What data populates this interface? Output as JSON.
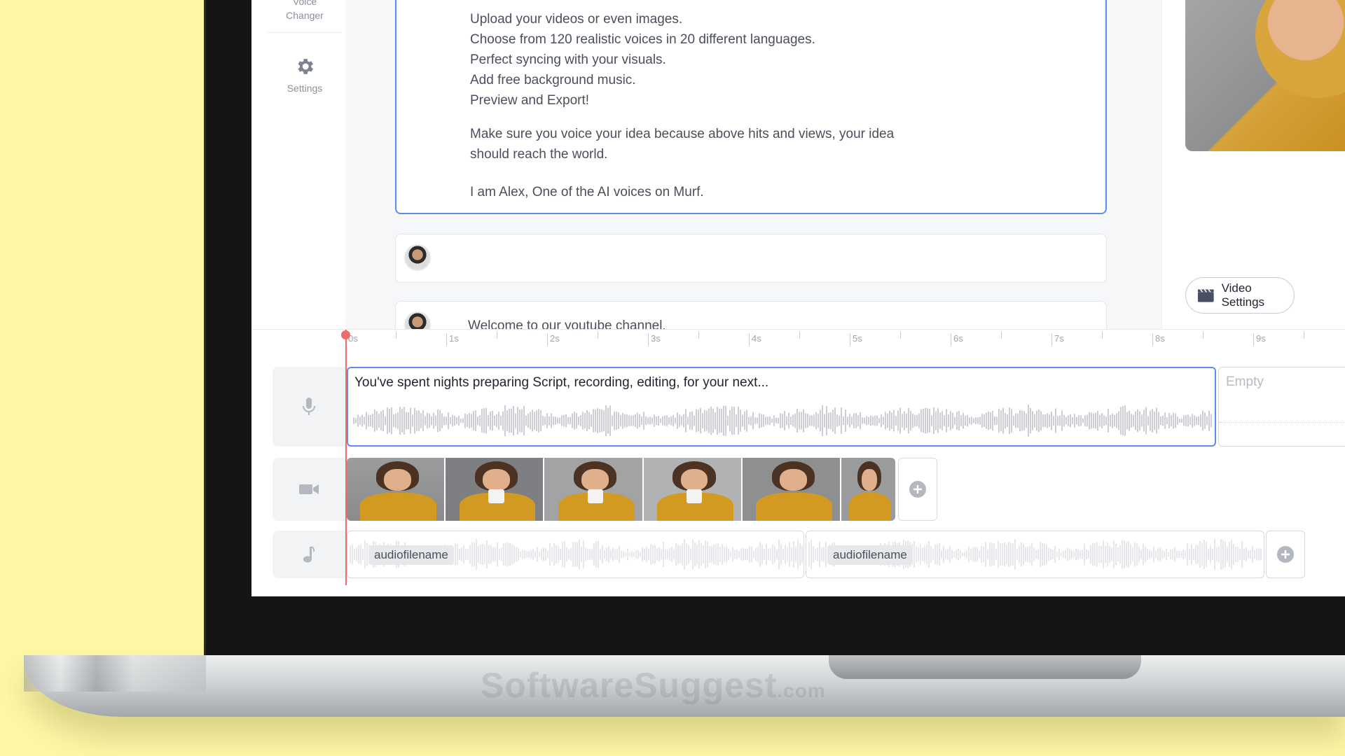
{
  "sidebar": {
    "items": [
      {
        "label_line1": "Voice",
        "label_line2": "Changer",
        "icon": "voice-changer-icon"
      },
      {
        "label": "Settings",
        "icon": "gear-icon"
      }
    ]
  },
  "script": {
    "lines": [
      "Upload your videos or even images.",
      "Choose from 120 realistic voices in 20 different languages.",
      "Perfect syncing with your visuals.",
      "Add free background music.",
      "Preview and Export!",
      "Make sure you voice your idea because above hits and views, your idea",
      "should reach the world.",
      "I am Alex, One of the AI voices on Murf."
    ],
    "block3_text": "Welcome to our youtube channel."
  },
  "right_panel": {
    "video_settings_label": "Video Settings"
  },
  "timeline": {
    "ruler_labels": [
      "0s",
      "1s",
      "2s",
      "3s",
      "4s",
      "5s",
      "6s",
      "7s",
      "8s",
      "9s"
    ],
    "voice_clip_text": "You've spent nights preparing Script, recording, editing, for your next...",
    "empty_clip_text": "Empty",
    "music_clips": [
      {
        "label": "audiofilename"
      },
      {
        "label": "audiofilename"
      }
    ],
    "track_icons": [
      "microphone-icon",
      "video-camera-icon",
      "music-note-icon"
    ]
  },
  "watermark": {
    "text": "SoftwareSuggest",
    "suffix": ".com"
  },
  "colors": {
    "accent": "#5b8def",
    "playhead": "#f06b6b",
    "background": "#fdf7a6"
  }
}
